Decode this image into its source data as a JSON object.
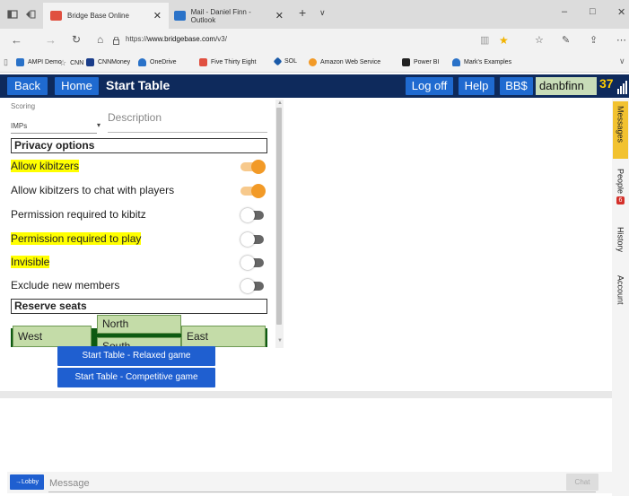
{
  "browser": {
    "tabs": [
      {
        "title": "Bridge Base Online",
        "active": true,
        "favicon_color": "#e05040"
      },
      {
        "title": "Mail - Daniel Finn - Outlook",
        "active": false,
        "favicon_color": "#2a72c8"
      }
    ],
    "new_tab": "+",
    "tab_menu": "∨",
    "url_prefix": "https://",
    "url_host": "www.bridgebase.com",
    "url_path": "/v3/",
    "favorites": [
      {
        "label": "AMPI Demo",
        "color": "#2a72c8"
      },
      {
        "label": "CNN",
        "color": "#999999"
      },
      {
        "label": "CNNMoney",
        "color": "#1a3d8a"
      },
      {
        "label": "OneDrive",
        "color": "#2a72c8"
      },
      {
        "label": "Five Thirty Eight",
        "color": "#e05040"
      },
      {
        "label": "SOL",
        "color": "#1a5aa8"
      },
      {
        "label": "Amazon Web Service",
        "color": "#f29a27"
      },
      {
        "label": "Power BI",
        "color": "#222222"
      },
      {
        "label": "Mark's Examples",
        "color": "#2a72c8"
      }
    ]
  },
  "header": {
    "back": "Back",
    "home": "Home",
    "title": "Start Table",
    "logoff": "Log off",
    "help": "Help",
    "bbs": "BB$",
    "username": "danbfinn",
    "number": "37"
  },
  "scoring": {
    "label": "Scoring",
    "value": "IMPs"
  },
  "description": {
    "placeholder": "Description"
  },
  "privacy": {
    "title": "Privacy options",
    "options": [
      {
        "label": "Allow kibitzers",
        "on": true,
        "highlighted": true
      },
      {
        "label": "Allow kibitzers to chat with players",
        "on": true,
        "highlighted": false
      },
      {
        "label": "Permission required to kibitz",
        "on": false,
        "highlighted": false
      },
      {
        "label": "Permission required to play",
        "on": false,
        "highlighted": true
      },
      {
        "label": "Invisible",
        "on": false,
        "highlighted": true
      },
      {
        "label": "Exclude new members",
        "on": false,
        "highlighted": false
      }
    ]
  },
  "reserve": {
    "title": "Reserve seats",
    "north": "North",
    "south": "South",
    "west": "West",
    "east": "East"
  },
  "buttons": {
    "relaxed": "Start Table - Relaxed game",
    "competitive": "Start Table - Competitive game"
  },
  "sidetabs": {
    "messages": "Messages",
    "people": "People",
    "people_badge": "6",
    "history": "History",
    "account": "Account"
  },
  "chat": {
    "lobby": "→Lobby",
    "placeholder": "Message",
    "send": "Chat"
  },
  "colors": {
    "header_bg": "#0e2a5c",
    "button_blue": "#1f6ad0",
    "toggle_on": "#f29a27",
    "seat_green": "#0e5a12",
    "highlight": "#ffff00"
  }
}
